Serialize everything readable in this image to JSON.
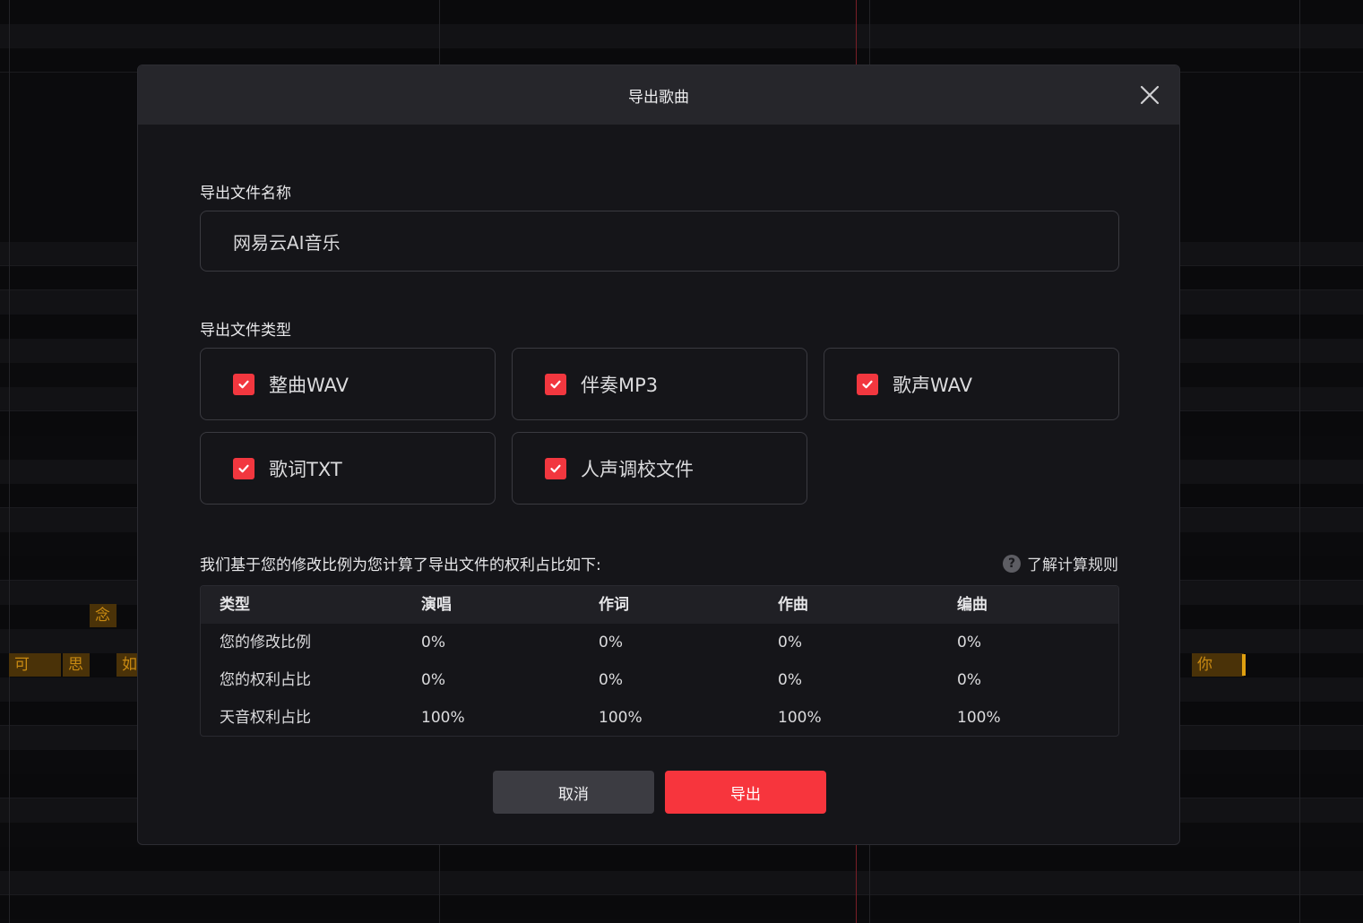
{
  "background": {
    "notes": [
      "可",
      "思",
      "如",
      "念",
      "你"
    ]
  },
  "dialog": {
    "title": "导出歌曲",
    "file_name_label": "导出文件名称",
    "file_name_value": "网易云AI音乐",
    "file_type_label": "导出文件类型",
    "file_types": [
      {
        "label": "整曲WAV",
        "checked": true
      },
      {
        "label": "伴奏MP3",
        "checked": true
      },
      {
        "label": "歌声WAV",
        "checked": true
      },
      {
        "label": "歌词TXT",
        "checked": true
      },
      {
        "label": "人声调校文件",
        "checked": true
      }
    ],
    "rights_note": "我们基于您的修改比例为您计算了导出文件的权利占比如下:",
    "rules_link": "了解计算规则",
    "table": {
      "headers": [
        "类型",
        "演唱",
        "作词",
        "作曲",
        "编曲"
      ],
      "rows": [
        [
          "您的修改比例",
          "0%",
          "0%",
          "0%",
          "0%"
        ],
        [
          "您的权利占比",
          "0%",
          "0%",
          "0%",
          "0%"
        ],
        [
          "天音权利占比",
          "100%",
          "100%",
          "100%",
          "100%"
        ]
      ]
    },
    "cancel_label": "取消",
    "export_label": "导出"
  },
  "colors": {
    "accent": "#f7353d",
    "note_bg": "#4a3208",
    "note_text": "#c98a12"
  }
}
